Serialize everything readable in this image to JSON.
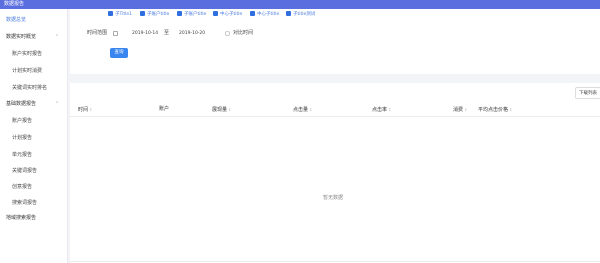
{
  "app": {
    "title": "数据报告"
  },
  "sidebar": {
    "home": "数据总览",
    "groups": [
      {
        "label": "数据实时概览",
        "items": [
          "账户实时报告",
          "计划实时消费",
          "关键词实时排名"
        ]
      },
      {
        "label": "基础数据报告",
        "items": [
          "账户报告",
          "计划报告",
          "单元报告",
          "关键词报告",
          "创意报告",
          "搜索词报告"
        ]
      }
    ],
    "last": "地域搜索报告"
  },
  "filters": {
    "checkboxes": [
      "子Title1",
      "子账户title",
      "子账户title",
      "中心子title",
      "中心子title",
      "子title测试"
    ],
    "time_range_label": "时间范围",
    "start_date": "2019-10-14",
    "to_label": "至",
    "end_date": "2019-10-20",
    "compare_label": "对比时间",
    "query_button": "查询"
  },
  "table": {
    "download_button": "下载列表",
    "columns": [
      "时间",
      "账户",
      "展现量",
      "点击量",
      "点击率",
      "消费",
      "平均点击价格"
    ],
    "empty_text": "暂无数据"
  },
  "colors": {
    "accent": "#3a86f0",
    "topbar": "#5b6ee0",
    "active": "#4a7be0"
  }
}
